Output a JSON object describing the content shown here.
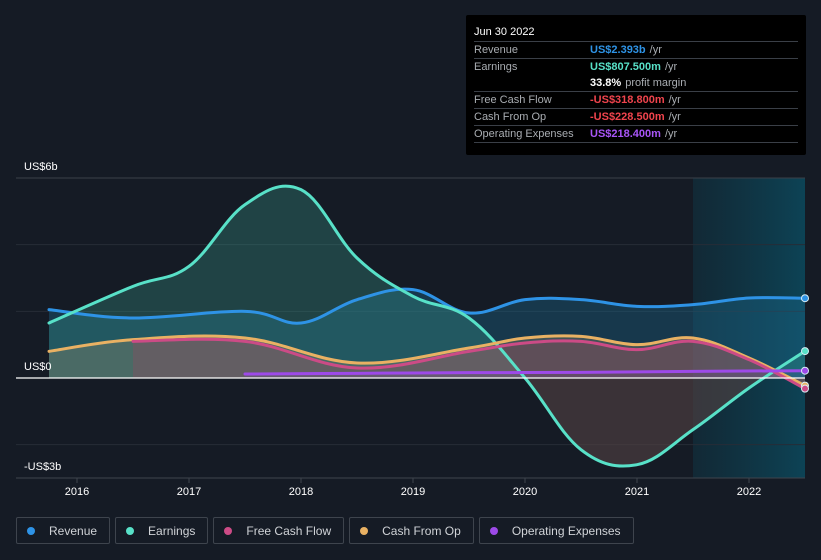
{
  "tooltip": {
    "date": "Jun 30 2022",
    "rows": [
      {
        "label": "Revenue",
        "value": "US$2.393b",
        "unit": "/yr",
        "color": "#2e93e6"
      },
      {
        "label": "Earnings",
        "value": "US$807.500m",
        "unit": "/yr",
        "color": "#58e1c8"
      },
      {
        "label": "",
        "margin_value": "33.8%",
        "margin_text": "profit margin"
      },
      {
        "label": "Free Cash Flow",
        "value": "-US$318.800m",
        "unit": "/yr",
        "color": "#f0444d"
      },
      {
        "label": "Cash From Op",
        "value": "-US$228.500m",
        "unit": "/yr",
        "color": "#f0444d"
      },
      {
        "label": "Operating Expenses",
        "value": "US$218.400m",
        "unit": "/yr",
        "color": "#a855f7"
      }
    ]
  },
  "legend": [
    {
      "label": "Revenue",
      "color": "#2e93e6"
    },
    {
      "label": "Earnings",
      "color": "#58e1c8"
    },
    {
      "label": "Free Cash Flow",
      "color": "#cc4b86"
    },
    {
      "label": "Cash From Op",
      "color": "#e9b163"
    },
    {
      "label": "Operating Expenses",
      "color": "#9d4ae8"
    }
  ],
  "chart_data": {
    "type": "area",
    "title": "",
    "xlabel": "",
    "ylabel": "",
    "y_unit": "US$ billions",
    "ylim": [
      -3,
      6
    ],
    "xlim": [
      2015.75,
      2022.5
    ],
    "y_tick_labels": [
      {
        "value": 6,
        "label": "US$6b"
      },
      {
        "value": 0,
        "label": "US$0"
      },
      {
        "value": -3,
        "label": "-US$3b"
      }
    ],
    "gridlines": [
      6,
      4,
      2,
      0,
      -2
    ],
    "x_ticks": [
      {
        "value": 2016,
        "label": "2016"
      },
      {
        "value": 2017,
        "label": "2017"
      },
      {
        "value": 2018,
        "label": "2018"
      },
      {
        "value": 2019,
        "label": "2019"
      },
      {
        "value": 2020,
        "label": "2020"
      },
      {
        "value": 2021,
        "label": "2021"
      },
      {
        "value": 2022,
        "label": "2022"
      }
    ],
    "highlight_range": [
      2021.5,
      2022.5
    ],
    "legend_position": "bottom",
    "series": [
      {
        "name": "Revenue",
        "color": "#2e93e6",
        "points": [
          [
            2015.75,
            2.05
          ],
          [
            2016.5,
            1.8
          ],
          [
            2017.5,
            2.0
          ],
          [
            2018.0,
            1.65
          ],
          [
            2018.5,
            2.35
          ],
          [
            2019.0,
            2.65
          ],
          [
            2019.5,
            1.95
          ],
          [
            2020.0,
            2.35
          ],
          [
            2020.5,
            2.35
          ],
          [
            2021.0,
            2.15
          ],
          [
            2021.5,
            2.2
          ],
          [
            2022.0,
            2.4
          ],
          [
            2022.5,
            2.393
          ]
        ]
      },
      {
        "name": "Earnings",
        "color": "#58e1c8",
        "points": [
          [
            2015.75,
            1.65
          ],
          [
            2016.5,
            2.75
          ],
          [
            2017.0,
            3.35
          ],
          [
            2017.5,
            5.2
          ],
          [
            2018.0,
            5.65
          ],
          [
            2018.5,
            3.6
          ],
          [
            2019.0,
            2.45
          ],
          [
            2019.5,
            1.8
          ],
          [
            2020.0,
            0.0
          ],
          [
            2020.5,
            -2.15
          ],
          [
            2021.0,
            -2.6
          ],
          [
            2021.5,
            -1.55
          ],
          [
            2022.0,
            -0.3
          ],
          [
            2022.5,
            0.8075
          ]
        ]
      },
      {
        "name": "Cash From Op",
        "color": "#e9b163",
        "points": [
          [
            2015.75,
            0.8
          ],
          [
            2016.5,
            1.15
          ],
          [
            2017.5,
            1.2
          ],
          [
            2018.5,
            0.45
          ],
          [
            2019.5,
            0.9
          ],
          [
            2020.0,
            1.2
          ],
          [
            2020.5,
            1.25
          ],
          [
            2021.0,
            1.0
          ],
          [
            2021.5,
            1.2
          ],
          [
            2022.0,
            0.6
          ],
          [
            2022.5,
            -0.2285
          ]
        ]
      },
      {
        "name": "Free Cash Flow",
        "color": "#cc4b86",
        "points": [
          [
            2016.5,
            1.1
          ],
          [
            2017.5,
            1.1
          ],
          [
            2018.5,
            0.3
          ],
          [
            2019.5,
            0.8
          ],
          [
            2020.0,
            1.05
          ],
          [
            2020.5,
            1.1
          ],
          [
            2021.0,
            0.85
          ],
          [
            2021.5,
            1.1
          ],
          [
            2022.0,
            0.55
          ],
          [
            2022.5,
            -0.3188
          ]
        ]
      },
      {
        "name": "Operating Expenses",
        "color": "#9d4ae8",
        "points": [
          [
            2017.5,
            0.12
          ],
          [
            2018.5,
            0.14
          ],
          [
            2019.5,
            0.16
          ],
          [
            2020.5,
            0.17
          ],
          [
            2021.5,
            0.2
          ],
          [
            2022.5,
            0.2184
          ]
        ]
      }
    ]
  }
}
